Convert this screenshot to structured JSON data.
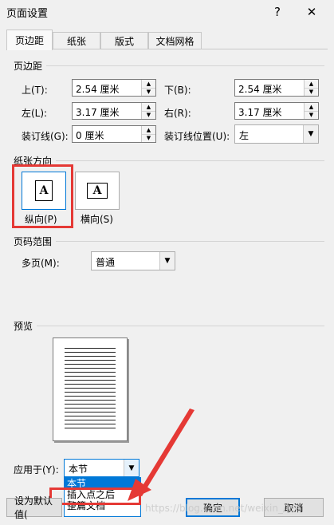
{
  "window": {
    "title": "页面设置",
    "help": "?",
    "close": "✕"
  },
  "tabs": [
    {
      "label": "页边距",
      "active": true
    },
    {
      "label": "纸张",
      "active": false
    },
    {
      "label": "版式",
      "active": false
    },
    {
      "label": "文档网格",
      "active": false
    }
  ],
  "margins": {
    "section": "页边距",
    "top_label": "上(T):",
    "top_value": "2.54 厘米",
    "bottom_label": "下(B):",
    "bottom_value": "2.54 厘米",
    "left_label": "左(L):",
    "left_value": "3.17 厘米",
    "right_label": "右(R):",
    "right_value": "3.17 厘米",
    "gutter_label": "装订线(G):",
    "gutter_value": "0 厘米",
    "gutter_pos_label": "装订线位置(U):",
    "gutter_pos_value": "左"
  },
  "orientation": {
    "section": "纸张方向",
    "portrait": "纵向(P)",
    "landscape": "横向(S)",
    "icon_letter": "A"
  },
  "pages": {
    "section": "页码范围",
    "multiple_label": "多页(M):",
    "multiple_value": "普通"
  },
  "preview": {
    "section": "预览"
  },
  "apply": {
    "label": "应用于(Y):",
    "value": "本节",
    "options": [
      "本节",
      "插入点之后",
      "整篇文档"
    ],
    "highlighted_index": 0
  },
  "buttons": {
    "set_default": "设为默认值(",
    "ok": "确定",
    "cancel": "取消"
  },
  "watermark": "https://blog.csdn.net/weixin_/lee",
  "colors": {
    "accent": "#0078d7",
    "annotation_red": "#e53935"
  }
}
